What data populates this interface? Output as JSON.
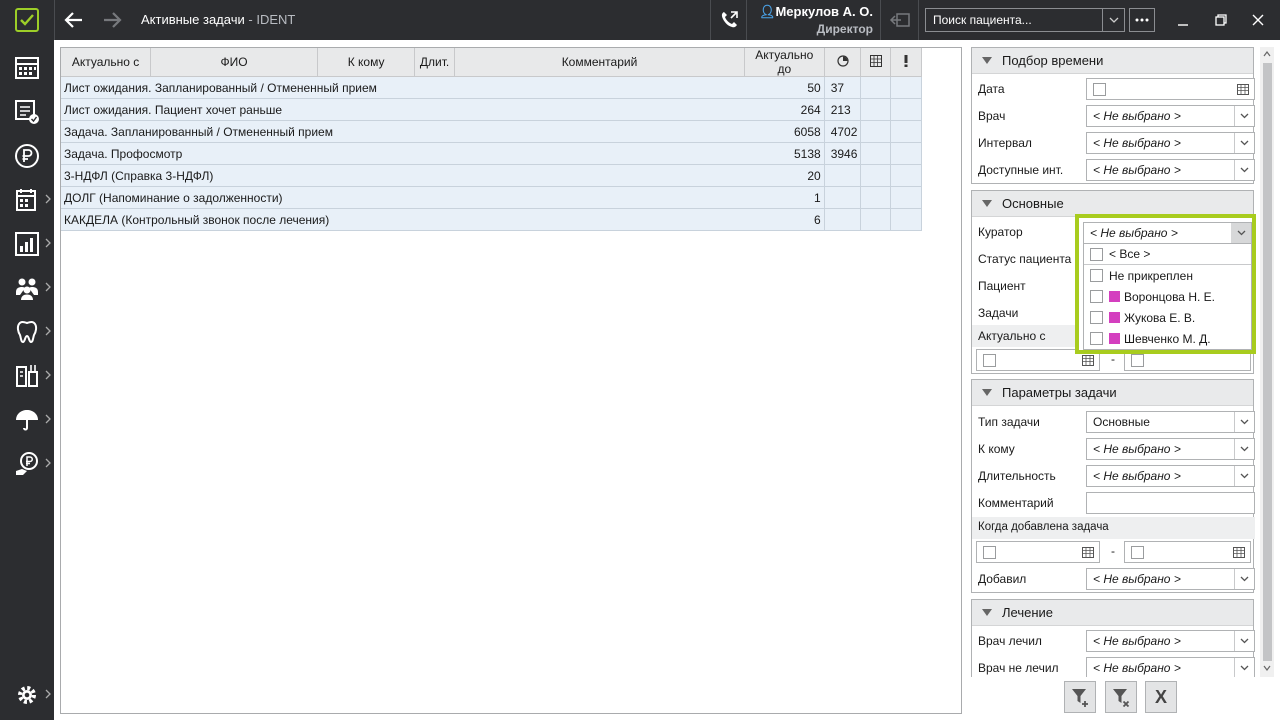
{
  "window": {
    "title": "Активные задачи",
    "app_name": "IDENT"
  },
  "user": {
    "name": "Меркулов А. О.",
    "role": "Директор"
  },
  "search": {
    "placeholder": "Поиск пациента..."
  },
  "colors": {
    "accent": "#a8cc1e",
    "dark_bg": "#2c2d30",
    "curator_tag": "#d43fbf"
  },
  "sidebar": {
    "items": [
      {
        "icon": "schedule-grid-icon"
      },
      {
        "icon": "tasks-list-icon"
      },
      {
        "icon": "ruble-icon"
      },
      {
        "icon": "reports-calendar-icon"
      },
      {
        "icon": "analytics-chart-icon"
      },
      {
        "icon": "patients-group-icon"
      },
      {
        "icon": "tooth-icon"
      },
      {
        "icon": "lab-devices-icon"
      },
      {
        "icon": "insurance-umbrella-icon"
      },
      {
        "icon": "payments-person-icon"
      },
      {
        "icon": "settings-gear-icon"
      }
    ]
  },
  "table": {
    "columns": [
      "Актуально с",
      "ФИО",
      "К кому",
      "Длит.",
      "Комментарий",
      "Актуально до"
    ],
    "rows": [
      {
        "name": "Лист ожидания. Запланированный / Отмененный прием",
        "a": "50",
        "b": "37"
      },
      {
        "name": "Лист ожидания. Пациент хочет раньше",
        "a": "264",
        "b": "213"
      },
      {
        "name": "Задача. Запланированный / Отмененный прием",
        "a": "6058",
        "b": "4702"
      },
      {
        "name": "Задача. Профосмотр",
        "a": "5138",
        "b": "3946"
      },
      {
        "name": "3-НДФЛ (Справка 3-НДФЛ)",
        "a": "20",
        "b": ""
      },
      {
        "name": "ДОЛГ (Напоминание о задолженности)",
        "a": "1",
        "b": ""
      },
      {
        "name": "КАКДЕЛА (Контрольный звонок после лечения)",
        "a": "6",
        "b": ""
      }
    ]
  },
  "panel": {
    "time": {
      "title": "Подбор времени",
      "date_label": "Дата",
      "doctor_label": "Врач",
      "doctor_value": "< Не выбрано >",
      "interval_label": "Интервал",
      "interval_value": "< Не выбрано >",
      "avail_label": "Доступные инт.",
      "avail_value": "< Не выбрано >"
    },
    "main": {
      "title": "Основные",
      "curator_label": "Куратор",
      "curator_value": "< Не выбрано >",
      "status_label": "Статус пациента",
      "patient_label": "Пациент",
      "tasks_label": "Задачи",
      "actual_label": "Актуально с",
      "dash": "-"
    },
    "params": {
      "title": "Параметры задачи",
      "type_label": "Тип задачи",
      "type_value": "Основные",
      "to_label": "К кому",
      "to_value": "< Не выбрано >",
      "dur_label": "Длительность",
      "dur_value": "< Не выбрано >",
      "comment_label": "Комментарий",
      "added_when_label": "Когда добавлена задача",
      "dash": "-",
      "added_by_label": "Добавил",
      "added_by_value": "< Не выбрано >"
    },
    "treatment": {
      "title": "Лечение",
      "treated_label": "Врач лечил",
      "treated_value": "< Не выбрано >",
      "not_treated_label": "Врач не лечил",
      "not_treated_value": "< Не выбрано >"
    }
  },
  "curator_popup": {
    "value": "< Не выбрано >",
    "options": [
      {
        "label": "< Все >",
        "tag": false
      },
      {
        "label": "Не прикреплен",
        "tag": false
      },
      {
        "label": "Воронцова Н. Е.",
        "tag": true
      },
      {
        "label": "Жукова Е. В.",
        "tag": true
      },
      {
        "label": "Шевченко М. Д.",
        "tag": true
      }
    ]
  },
  "filter_buttons": {
    "clear_label": "X"
  }
}
